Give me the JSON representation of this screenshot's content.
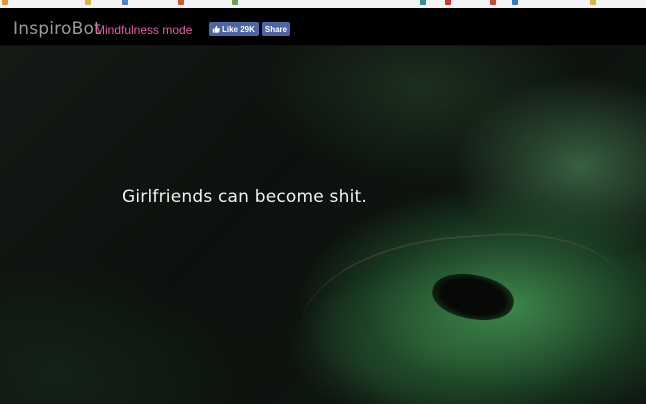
{
  "header": {
    "brand": "InspiroBot",
    "mode_link": "Mindfulness mode",
    "like_label": "Like 29K",
    "share_label": "Share"
  },
  "quote": "Girlfriends can become shit.",
  "colors": {
    "header_bg": "#000000",
    "brand": "#9a9a9a",
    "mode_link": "#e35fa3",
    "facebook": "#4a67a4",
    "quote_text": "#f2f2f2"
  },
  "icons": {
    "like": "thumbs-up-icon"
  }
}
